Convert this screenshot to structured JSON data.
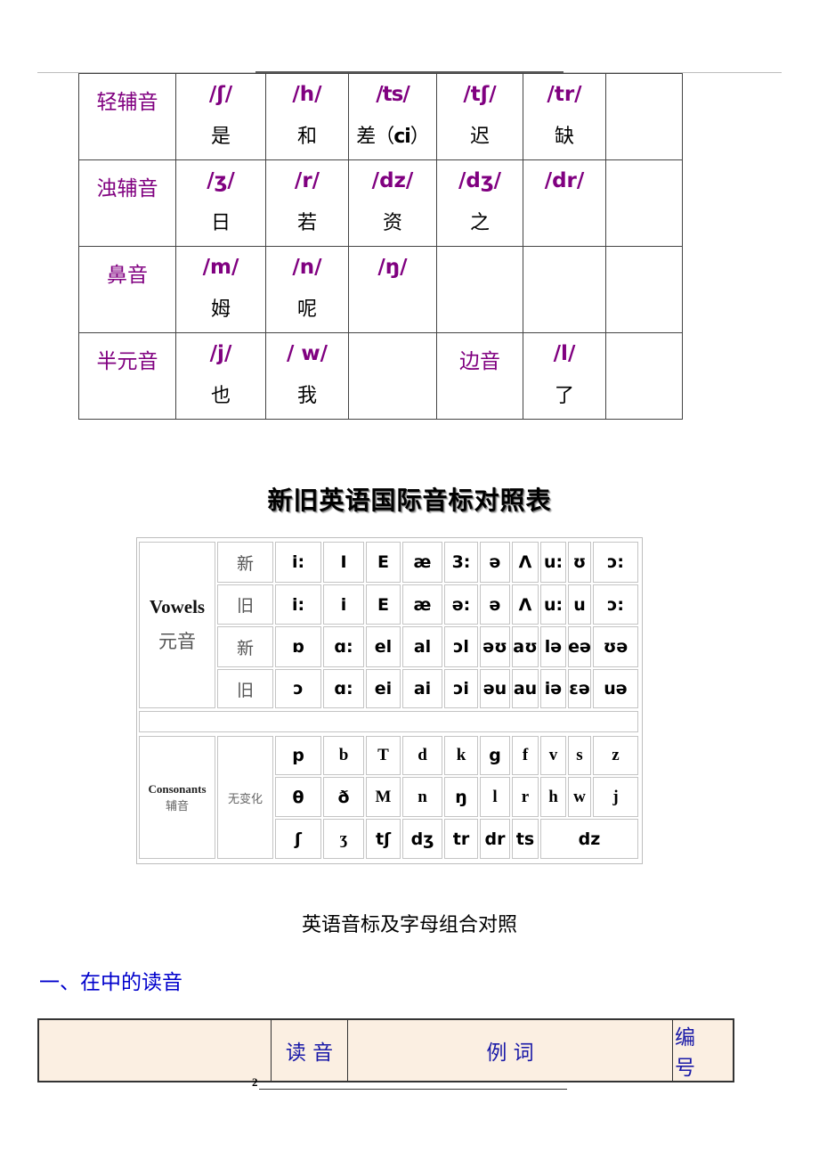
{
  "consonant_table": {
    "rows": [
      {
        "category": "轻辅音",
        "cells": [
          {
            "symbol": "/ʃ/",
            "example": "是"
          },
          {
            "symbol": "/h/",
            "example": "和"
          },
          {
            "symbol": "/ts/",
            "example": "差（",
            "example_suffix": "ci",
            "example_close": "）"
          },
          {
            "symbol": "/tʃ/",
            "example": "迟"
          },
          {
            "symbol": "/tr/",
            "example": "缺"
          },
          {
            "symbol": "",
            "example": ""
          }
        ]
      },
      {
        "category": "浊辅音",
        "cells": [
          {
            "symbol": "/ʒ/",
            "example": "日"
          },
          {
            "symbol": "/r/",
            "example": "若"
          },
          {
            "symbol": "/dz/",
            "example": "资"
          },
          {
            "symbol": "/dʒ/",
            "example": "之"
          },
          {
            "symbol": "/dr/",
            "example": ""
          },
          {
            "symbol": "",
            "example": ""
          }
        ]
      },
      {
        "category": "鼻音",
        "cells": [
          {
            "symbol": "/m/",
            "example": "姆"
          },
          {
            "symbol": "/n/",
            "example": "呢"
          },
          {
            "symbol": "/ŋ/",
            "example": ""
          },
          {
            "symbol": "",
            "example": ""
          },
          {
            "symbol": "",
            "example": ""
          },
          {
            "symbol": "",
            "example": ""
          }
        ]
      },
      {
        "category": "半元音",
        "cells": [
          {
            "symbol": "/j/",
            "example": "也"
          },
          {
            "symbol": "/ w/",
            "example": "我"
          },
          {
            "symbol": "",
            "example": ""
          },
          {
            "symbol": "",
            "category": "边音",
            "example": ""
          },
          {
            "symbol": "/l/",
            "example": "了"
          },
          {
            "symbol": "",
            "example": ""
          }
        ]
      }
    ]
  },
  "ipa_title": "新旧英语国际音标对照表",
  "ipa_table": {
    "vowels_label_en": "Vowels",
    "vowels_label_zh": "元音",
    "new_label": "新",
    "old_label": "旧",
    "vowel_rows": [
      [
        "i:",
        "I",
        "E",
        "æ",
        "3:",
        "ə",
        "Λ",
        "u:",
        "ʊ",
        "ɔ:"
      ],
      [
        "i:",
        "i",
        "E",
        "æ",
        "ə:",
        "ə",
        "Λ",
        "u:",
        "u",
        "ɔ:"
      ],
      [
        "ɒ",
        "ɑ:",
        "el",
        "al",
        "ɔl",
        "əʊ",
        "aʊ",
        "lə",
        "eə",
        "ʊə"
      ],
      [
        "ɔ",
        "ɑ:",
        "ei",
        "ai",
        "ɔi",
        "əu",
        "au",
        "iə",
        "ɛə",
        "uə"
      ]
    ],
    "consonants_label_en": "Consonants",
    "consonants_label_zh": "辅音",
    "no_change_label": "无变化",
    "consonant_rows": [
      [
        "p",
        "b",
        "T",
        "d",
        "k",
        "g",
        "f",
        "v",
        "s",
        "z"
      ],
      [
        "θ",
        "ð",
        "M",
        "n",
        "ŋ",
        "l",
        "r",
        "h",
        "w",
        "j"
      ],
      [
        "ʃ",
        "ʒ",
        "tʃ",
        "dʒ",
        "tr",
        "dr",
        "ts",
        "dz"
      ]
    ]
  },
  "subtitle": "英语音标及字母组合对照",
  "section_heading": "一、在中的读音",
  "words_table": {
    "headers": [
      "",
      "读 音",
      "例 词",
      "编号"
    ]
  },
  "footer": {
    "page_number": "2"
  }
}
